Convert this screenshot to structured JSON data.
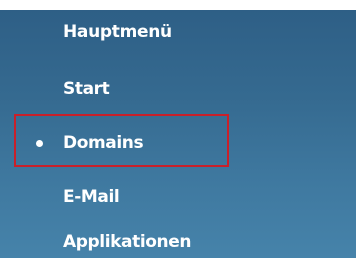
{
  "menu": {
    "title": "Hauptmenü",
    "items": [
      {
        "label": "Start",
        "active": false
      },
      {
        "label": "Domains",
        "active": true
      },
      {
        "label": "E-Mail",
        "active": false
      },
      {
        "label": "Applikationen",
        "active": false
      }
    ]
  },
  "colors": {
    "panel_top": "#2e5f86",
    "panel_bottom": "#4683aa",
    "text": "#ffffff",
    "highlight_border": "#c9202a"
  },
  "icons": {
    "active_marker": "bullet-icon"
  }
}
